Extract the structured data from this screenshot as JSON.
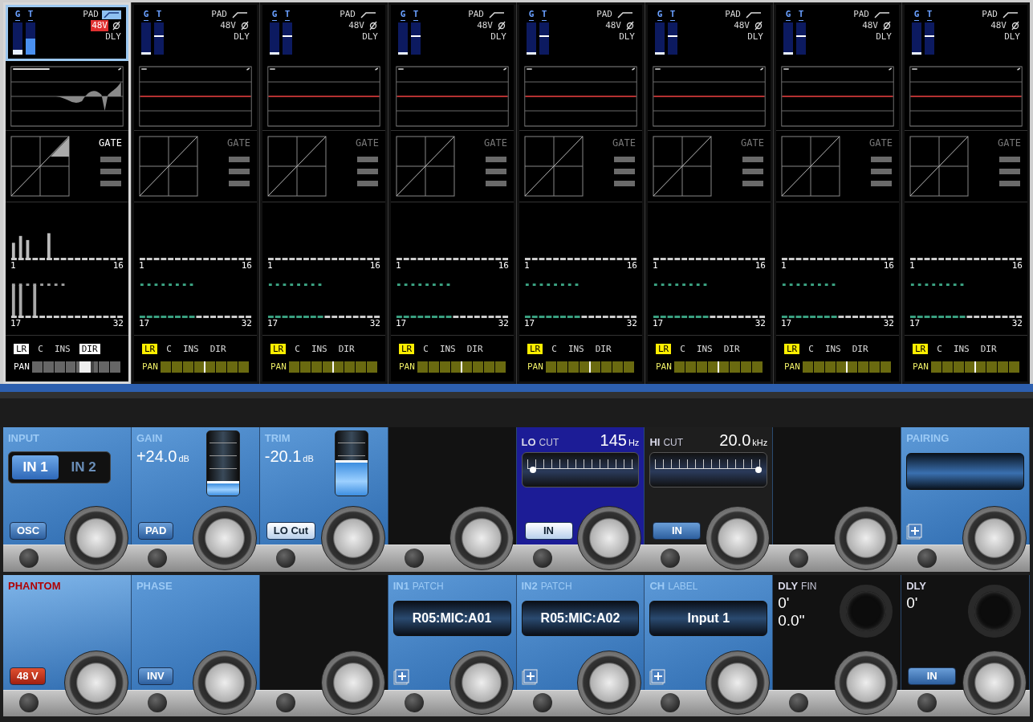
{
  "channels": [
    {
      "selected": true,
      "g": "G",
      "t": "T",
      "gain_meter": {
        "level": 0.15
      },
      "trim_meter": {
        "level": 0.5
      },
      "pad": "PAD",
      "lo_cut_on": true,
      "phantom": "48V",
      "phantom_on": true,
      "dly": "DLY",
      "eq_on": true,
      "gate": "GATE",
      "gate_on": true,
      "signal": true,
      "bus_meters": [
        {
          "start": "1",
          "end": "16"
        },
        {
          "start": "17",
          "end": "32"
        }
      ],
      "routing": [
        {
          "label": "LR",
          "on": true
        },
        {
          "label": "C",
          "on": false
        },
        {
          "label": "INS",
          "on": false
        },
        {
          "label": "DIR",
          "on": true
        }
      ],
      "pan": {
        "label": "PAN",
        "level": 0.62
      }
    },
    {
      "selected": false,
      "g": "G",
      "t": "T",
      "gain_meter": {
        "level": 0.08
      },
      "trim_meter": {
        "level": 0.6
      },
      "pad": "PAD",
      "lo_cut_on": false,
      "phantom": "48V",
      "phantom_on": false,
      "dly": "DLY",
      "eq_on": false,
      "gate": "GATE",
      "gate_on": false,
      "signal": false,
      "bus_meters": [
        {
          "start": "1",
          "end": "16"
        },
        {
          "start": "17",
          "end": "32"
        }
      ],
      "routing": [
        {
          "label": "LR",
          "on": true
        },
        {
          "label": "C",
          "on": false
        },
        {
          "label": "INS",
          "on": false
        },
        {
          "label": "DIR",
          "on": false
        }
      ],
      "pan": {
        "label": "PAN",
        "level": 0.5
      }
    },
    {
      "selected": false,
      "g": "G",
      "t": "T",
      "gain_meter": {
        "level": 0.08
      },
      "trim_meter": {
        "level": 0.6
      },
      "pad": "PAD",
      "lo_cut_on": false,
      "phantom": "48V",
      "phantom_on": false,
      "dly": "DLY",
      "eq_on": false,
      "gate": "GATE",
      "gate_on": false,
      "signal": false,
      "bus_meters": [
        {
          "start": "1",
          "end": "16"
        },
        {
          "start": "17",
          "end": "32"
        }
      ],
      "routing": [
        {
          "label": "LR",
          "on": true
        },
        {
          "label": "C",
          "on": false
        },
        {
          "label": "INS",
          "on": false
        },
        {
          "label": "DIR",
          "on": false
        }
      ],
      "pan": {
        "label": "PAN",
        "level": 0.5
      }
    },
    {
      "selected": false,
      "g": "G",
      "t": "T",
      "gain_meter": {
        "level": 0.08
      },
      "trim_meter": {
        "level": 0.6
      },
      "pad": "PAD",
      "lo_cut_on": false,
      "phantom": "48V",
      "phantom_on": false,
      "dly": "DLY",
      "eq_on": false,
      "gate": "GATE",
      "gate_on": false,
      "signal": false,
      "bus_meters": [
        {
          "start": "1",
          "end": "16"
        },
        {
          "start": "17",
          "end": "32"
        }
      ],
      "routing": [
        {
          "label": "LR",
          "on": true
        },
        {
          "label": "C",
          "on": false
        },
        {
          "label": "INS",
          "on": false
        },
        {
          "label": "DIR",
          "on": false
        }
      ],
      "pan": {
        "label": "PAN",
        "level": 0.5
      }
    },
    {
      "selected": false,
      "g": "G",
      "t": "T",
      "gain_meter": {
        "level": 0.08
      },
      "trim_meter": {
        "level": 0.6
      },
      "pad": "PAD",
      "lo_cut_on": false,
      "phantom": "48V",
      "phantom_on": false,
      "dly": "DLY",
      "eq_on": false,
      "gate": "GATE",
      "gate_on": false,
      "signal": false,
      "bus_meters": [
        {
          "start": "1",
          "end": "16"
        },
        {
          "start": "17",
          "end": "32"
        }
      ],
      "routing": [
        {
          "label": "LR",
          "on": true
        },
        {
          "label": "C",
          "on": false
        },
        {
          "label": "INS",
          "on": false
        },
        {
          "label": "DIR",
          "on": false
        }
      ],
      "pan": {
        "label": "PAN",
        "level": 0.5
      }
    },
    {
      "selected": false,
      "g": "G",
      "t": "T",
      "gain_meter": {
        "level": 0.08
      },
      "trim_meter": {
        "level": 0.6
      },
      "pad": "PAD",
      "lo_cut_on": false,
      "phantom": "48V",
      "phantom_on": false,
      "dly": "DLY",
      "eq_on": false,
      "gate": "GATE",
      "gate_on": false,
      "signal": false,
      "bus_meters": [
        {
          "start": "1",
          "end": "16"
        },
        {
          "start": "17",
          "end": "32"
        }
      ],
      "routing": [
        {
          "label": "LR",
          "on": true
        },
        {
          "label": "C",
          "on": false
        },
        {
          "label": "INS",
          "on": false
        },
        {
          "label": "DIR",
          "on": false
        }
      ],
      "pan": {
        "label": "PAN",
        "level": 0.5
      }
    },
    {
      "selected": false,
      "g": "G",
      "t": "T",
      "gain_meter": {
        "level": 0.08
      },
      "trim_meter": {
        "level": 0.6
      },
      "pad": "PAD",
      "lo_cut_on": false,
      "phantom": "48V",
      "phantom_on": false,
      "dly": "DLY",
      "eq_on": false,
      "gate": "GATE",
      "gate_on": false,
      "signal": false,
      "bus_meters": [
        {
          "start": "1",
          "end": "16"
        },
        {
          "start": "17",
          "end": "32"
        }
      ],
      "routing": [
        {
          "label": "LR",
          "on": true
        },
        {
          "label": "C",
          "on": false
        },
        {
          "label": "INS",
          "on": false
        },
        {
          "label": "DIR",
          "on": false
        }
      ],
      "pan": {
        "label": "PAN",
        "level": 0.5
      }
    },
    {
      "selected": false,
      "g": "G",
      "t": "T",
      "gain_meter": {
        "level": 0.08
      },
      "trim_meter": {
        "level": 0.6
      },
      "pad": "PAD",
      "lo_cut_on": false,
      "phantom": "48V",
      "phantom_on": false,
      "dly": "DLY",
      "eq_on": false,
      "gate": "GATE",
      "gate_on": false,
      "signal": false,
      "bus_meters": [
        {
          "start": "1",
          "end": "16"
        },
        {
          "start": "17",
          "end": "32"
        }
      ],
      "routing": [
        {
          "label": "LR",
          "on": true
        },
        {
          "label": "C",
          "on": false
        },
        {
          "label": "INS",
          "on": false
        },
        {
          "label": "DIR",
          "on": false
        }
      ],
      "pan": {
        "label": "PAN",
        "level": 0.5
      }
    }
  ],
  "controls": [
    {
      "kind": "selector",
      "title": "INPUT",
      "options": [
        {
          "label": "IN 1",
          "selected": true
        },
        {
          "label": "IN 2",
          "selected": false
        }
      ],
      "button": {
        "label": "OSC",
        "on": false
      }
    },
    {
      "kind": "meter",
      "title": "GAIN",
      "value": "+24.0",
      "unit": "dB",
      "level": 0.22,
      "button": {
        "label": "PAD",
        "on": false
      }
    },
    {
      "kind": "meter",
      "title": "TRIM",
      "value": "-20.1",
      "unit": "dB",
      "level": 0.55,
      "button": {
        "label": "LO Cut",
        "on": true
      }
    },
    {
      "kind": "empty"
    },
    {
      "kind": "filter",
      "title": "LO",
      "subtitle": "CUT",
      "value": "145",
      "unit": "Hz",
      "level": 0.03,
      "button": {
        "label": "IN",
        "on": true
      }
    },
    {
      "kind": "filter",
      "title": "HI",
      "subtitle": "CUT",
      "value": "20.0",
      "unit": "kHz",
      "level": 1,
      "button": {
        "label": "IN",
        "on": false
      }
    },
    {
      "kind": "empty"
    },
    {
      "kind": "pairing",
      "title": "PAIRING"
    },
    {
      "kind": "toggle",
      "title": "PHANTOM",
      "button": {
        "label": "48 V",
        "on": true
      }
    },
    {
      "kind": "toggle",
      "title": "PHASE",
      "button": {
        "label": "INV",
        "on": false
      }
    },
    {
      "kind": "empty"
    },
    {
      "kind": "patch",
      "title": "IN1",
      "subtitle": "PATCH",
      "value": "R05:MIC:A01"
    },
    {
      "kind": "patch",
      "title": "IN2",
      "subtitle": "PATCH",
      "value": "R05:MIC:A02"
    },
    {
      "kind": "patch",
      "title": "CH",
      "subtitle": "LABEL",
      "value": "Input 1"
    },
    {
      "kind": "delay",
      "title": "DLY",
      "subtitle": "FIN",
      "lines": [
        "0'",
        "0.0\""
      ]
    },
    {
      "kind": "delay",
      "title": "DLY",
      "lines": [
        "0'"
      ],
      "button": {
        "label": "IN",
        "on": false
      }
    }
  ]
}
